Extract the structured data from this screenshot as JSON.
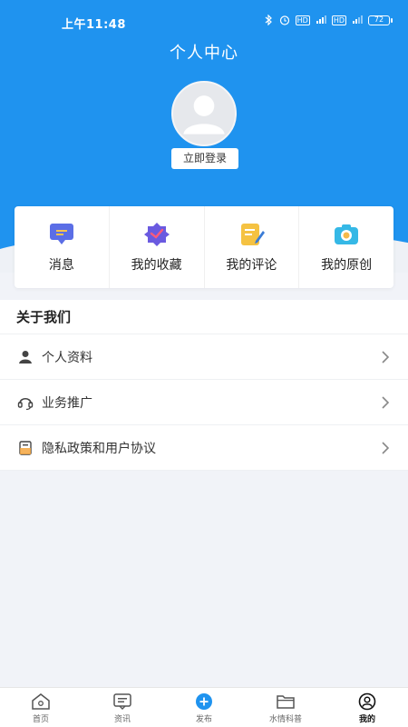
{
  "status_bar": {
    "time": "上午11:48",
    "icons": [
      "bluetooth-icon",
      "alarm-icon",
      "hd-icon",
      "signal-icon",
      "hd-icon",
      "signal-icon",
      "battery-icon"
    ],
    "hd_label": "HD",
    "battery": "72"
  },
  "header": {
    "title": "个人中心",
    "login_label": "立即登录",
    "background_color": "#1f93ef"
  },
  "quick_actions": [
    {
      "label": "消息",
      "icon": "message-icon",
      "color": "#5b6ee6"
    },
    {
      "label": "我的收藏",
      "icon": "favorites-icon",
      "color": "#6a5ae0"
    },
    {
      "label": "我的评论",
      "icon": "comment-edit-icon",
      "color": "#f5c242"
    },
    {
      "label": "我的原创",
      "icon": "camera-icon",
      "color": "#35b8e6"
    }
  ],
  "about": {
    "title": "关于我们",
    "items": [
      {
        "label": "个人资料",
        "icon": "person-icon"
      },
      {
        "label": "业务推广",
        "icon": "headset-icon"
      },
      {
        "label": "隐私政策和用户协议",
        "icon": "document-icon"
      }
    ]
  },
  "tabbar": {
    "items": [
      {
        "label": "首页",
        "icon": "home-icon",
        "active": false
      },
      {
        "label": "资讯",
        "icon": "news-icon",
        "active": false
      },
      {
        "label": "发布",
        "icon": "publish-plus-icon",
        "active": false
      },
      {
        "label": "水情科普",
        "icon": "folder-icon",
        "active": false
      },
      {
        "label": "我的",
        "icon": "profile-icon",
        "active": true
      }
    ],
    "accent": "#1f93ef"
  }
}
